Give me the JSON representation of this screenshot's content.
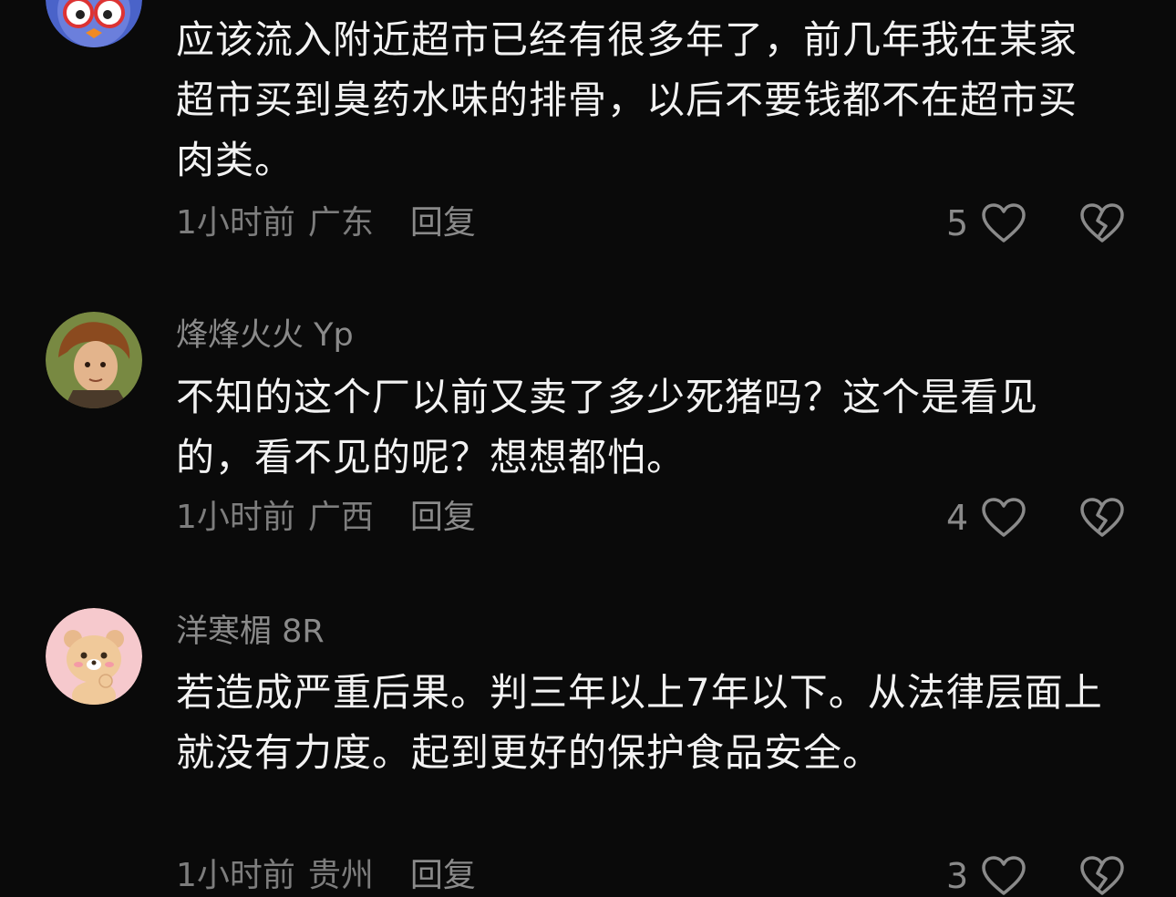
{
  "comments": [
    {
      "username": "",
      "text": "应该流入附近超市已经有很多年了，前几年我在某家超市买到臭药水味的排骨，以后不要钱都不在超市买肉类。",
      "time": "1小时前",
      "location": "广东",
      "reply_label": "回复",
      "likes": "5",
      "avatar_icon": "owl-cartoon-avatar"
    },
    {
      "username": "烽烽火火 Yp",
      "text": "不知的这个厂以前又卖了多少死猪吗？这个是看见的，看不见的呢？想想都怕。",
      "time": "1小时前",
      "location": "广西",
      "reply_label": "回复",
      "likes": "4",
      "avatar_icon": "game-character-avatar"
    },
    {
      "username": "洋寒楣 8R",
      "text": "若造成严重后果。判三年以上7年以下。从法律层面上就没有力度。起到更好的保护食品安全。",
      "time": "1小时前",
      "location": "贵州",
      "reply_label": "回复",
      "likes": "3",
      "avatar_icon": "bear-cartoon-avatar"
    }
  ],
  "icons": {
    "like": "heart-outline-icon",
    "dislike": "broken-heart-icon"
  },
  "colors": {
    "background": "#0a0a0a",
    "text": "#f2f2f2",
    "muted": "#8a8a8a"
  }
}
